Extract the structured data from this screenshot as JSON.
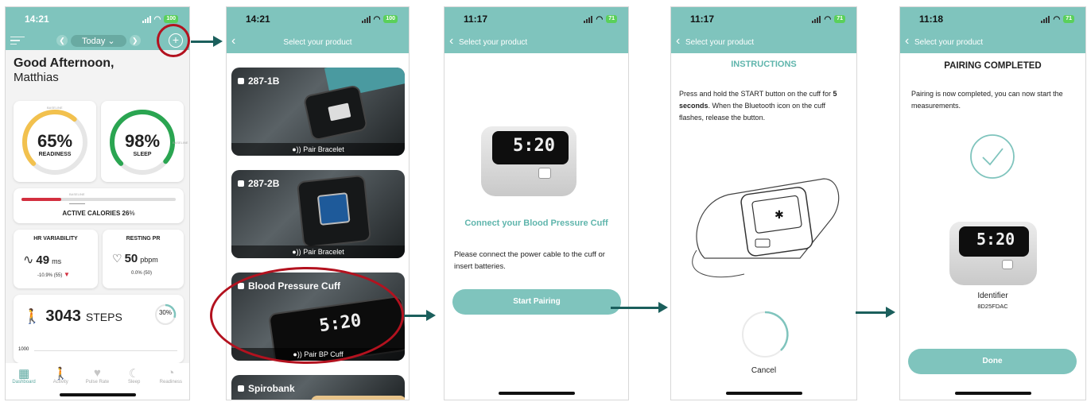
{
  "phone1": {
    "time": "14:21",
    "battery": "100",
    "date_label": "Today",
    "greeting": "Good Afternoon,",
    "user_name": "Matthias",
    "readiness": {
      "value": "65%",
      "label": "READINESS",
      "baseline": "BASELINE",
      "fraction": 0.65
    },
    "sleep": {
      "value": "98%",
      "label": "SLEEP",
      "baseline": "BASELINE",
      "fraction": 0.98
    },
    "calories": {
      "label": "ACTIVE CALORIES",
      "value": "26",
      "suffix": "%",
      "baseline": "BASELINE",
      "fraction": 0.26
    },
    "hrv": {
      "title": "HR VARIABILITY",
      "value": "49",
      "unit": "ms",
      "change": "-10.9% (55)"
    },
    "resting": {
      "title": "RESTING PR",
      "value": "50",
      "unit": "pbpm",
      "change": "0.0% (50)"
    },
    "steps": {
      "value": "3043",
      "label": "STEPS",
      "percent": "30",
      "axis": "1000"
    },
    "tabs": [
      "Dashboard",
      "Activity",
      "Pulse Rate",
      "Sleep",
      "Readiness"
    ]
  },
  "phone2": {
    "time": "14:21",
    "battery": "100",
    "title": "Select your product",
    "products": [
      {
        "name": "287-1B",
        "action": "Pair Bracelet"
      },
      {
        "name": "287-2B",
        "action": "Pair Bracelet"
      },
      {
        "name": "Blood Pressure Cuff",
        "action": "Pair BP Cuff"
      },
      {
        "name": "Spirobank",
        "action": ""
      }
    ]
  },
  "phone3": {
    "time": "11:17",
    "battery": "71",
    "back_label": "Select your product",
    "heading": "Connect your Blood Pressure Cuff",
    "body": "Please connect the power cable to the cuff or insert batteries.",
    "button": "Start Pairing",
    "display": "5:20"
  },
  "phone4": {
    "time": "11:17",
    "battery": "71",
    "back_label": "Select your product",
    "heading": "INSTRUCTIONS",
    "text_a": "Press and hold the START button on the cuff for ",
    "text_b": "5 seconds",
    "text_c": ". When the Bluetooth icon on the cuff flashes, release the button.",
    "cancel": "Cancel"
  },
  "phone5": {
    "time": "11:18",
    "battery": "71",
    "back_label": "Select your product",
    "heading": "PAIRING COMPLETED",
    "body": "Pairing is now completed, you can now start the measurements.",
    "identifier_label": "Identifier",
    "identifier_value": "8D25FDAC",
    "button": "Done"
  },
  "colors": {
    "teal": "#7fc4bd",
    "dark_teal": "#1b5f5c",
    "highlight_red": "#b3121f",
    "gauge_yellow": "#f2c14e",
    "gauge_green": "#2aa551"
  }
}
